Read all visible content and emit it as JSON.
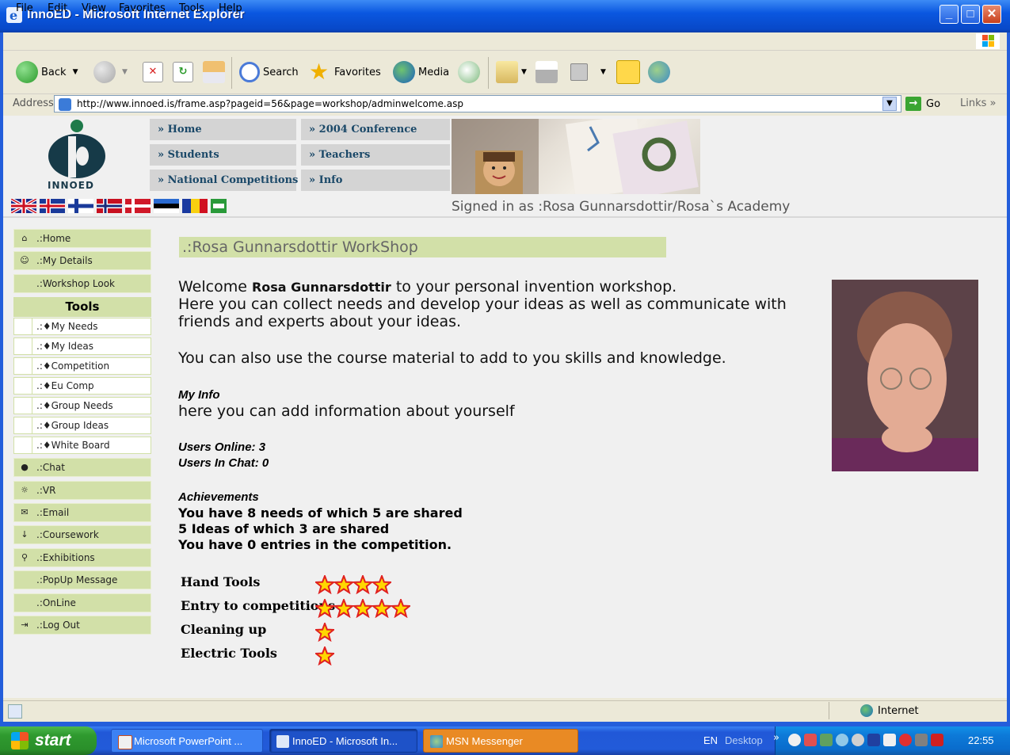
{
  "window": {
    "title": "InnoED - Microsoft Internet Explorer"
  },
  "menubar": {
    "items": [
      "File",
      "Edit",
      "View",
      "Favorites",
      "Tools",
      "Help"
    ]
  },
  "toolbar": {
    "back_label": "Back",
    "search_label": "Search",
    "favorites_label": "Favorites",
    "media_label": "Media"
  },
  "address": {
    "label": "Address",
    "url": "http://www.innoed.is/frame.asp?pageid=56&page=workshop/adminwelcome.asp",
    "go_label": "Go",
    "links_label": "Links"
  },
  "site": {
    "logo_text": "INNOED",
    "nav": {
      "home": "» Home",
      "conference": "» 2004 Conference",
      "students": "» Students",
      "teachers": "» Teachers",
      "national": "» National Competitions",
      "info": "» Info"
    },
    "signed_in": "Signed in as :Rosa Gunnarsdottir/Rosa`s Academy"
  },
  "left_menu": {
    "home": ".:Home",
    "my_details": ".:My Details",
    "workshop_look": ".:Workshop Look",
    "tools_heading": "Tools",
    "tools": [
      ".:♦My Needs",
      ".:♦My Ideas",
      ".:♦Competition",
      ".:♦Eu Comp",
      ".:♦Group Needs",
      ".:♦Group Ideas",
      ".:♦White Board"
    ],
    "chat": ".:Chat",
    "vr": ".:VR",
    "email": ".:Email",
    "coursework": ".:Coursework",
    "exhibitions": ".:Exhibitions",
    "popup": ".:PopUp Message",
    "online": ".:OnLine",
    "logout": ".:Log Out"
  },
  "main": {
    "workshop_title": ".:Rosa Gunnarsdottir WorkShop",
    "welcome_pre": "Welcome ",
    "welcome_name": "Rosa Gunnarsdottir",
    "welcome_post": " to your personal invention workshop.",
    "line2": "Here you can collect needs and develop your ideas as well as communicate with",
    "line3": "friends and experts about your ideas.",
    "line4": "You can also use the course material to add to you skills and knowledge.",
    "my_info_heading": "My Info",
    "my_info_text": "here you can add information about yourself",
    "users_online_label": "Users Online:",
    "users_online": "3",
    "users_chat_label": "Users In Chat:",
    "users_chat": "0",
    "achievements_heading": "Achievements",
    "achievements": [
      "You have 8 needs of which 5 are shared",
      "5 Ideas of which 3 are shared",
      "You have 0 entries in the competition."
    ],
    "skills": [
      {
        "label": "Hand Tools",
        "stars": 4
      },
      {
        "label": "Entry to competitions",
        "stars": 5
      },
      {
        "label": "Cleaning up",
        "stars": 1
      },
      {
        "label": "Electric Tools",
        "stars": 1
      }
    ]
  },
  "statusbar": {
    "zone": "Internet"
  },
  "taskbar": {
    "start": "start",
    "tasks": [
      "Microsoft PowerPoint ...",
      "InnoED - Microsoft In...",
      "MSN Messenger"
    ],
    "lang": "EN",
    "desktop": "Desktop",
    "clock": "22:55"
  },
  "colors": {
    "menu_green": "#d2e0a8",
    "nav_text": "#1a4868",
    "star_fill": "#ffd700",
    "star_stroke": "#e02020"
  }
}
